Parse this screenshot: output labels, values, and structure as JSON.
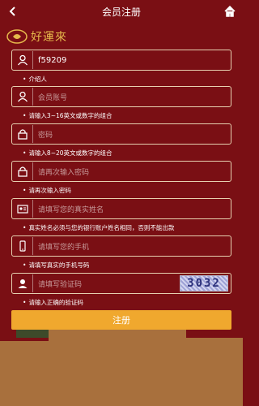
{
  "header": {
    "title": "会员注册"
  },
  "logo": {
    "text": "好運來"
  },
  "form": {
    "introducer": {
      "value": "f59209",
      "hint": "介绍人"
    },
    "account": {
      "placeholder": "会员账号",
      "hint": "请输入3~16英文或数字的组合"
    },
    "password": {
      "placeholder": "密码",
      "hint": "请输入8~20英文或数字的组合"
    },
    "password_confirm": {
      "placeholder": "请再次输入密码",
      "hint": "请再次输入密码"
    },
    "real_name": {
      "placeholder": "请填写您的真实姓名",
      "hint": "真实姓名必须与您的银行账户姓名相同，否则不能出款"
    },
    "phone": {
      "placeholder": "请填写您的手机",
      "hint": "请填写真实的手机号码"
    },
    "captcha": {
      "placeholder": "请填写验证码",
      "image_text": "3032",
      "hint": "请输入正确的验证码"
    }
  },
  "submit_label": "注册",
  "colors": {
    "background": "#7a0f14",
    "accent": "#f0a82e",
    "logo": "#e6b94c"
  },
  "icons": [
    "back-arrow-icon",
    "home-icon",
    "user-icon",
    "lock-icon",
    "id-card-icon",
    "phone-icon",
    "captcha-user-icon"
  ]
}
